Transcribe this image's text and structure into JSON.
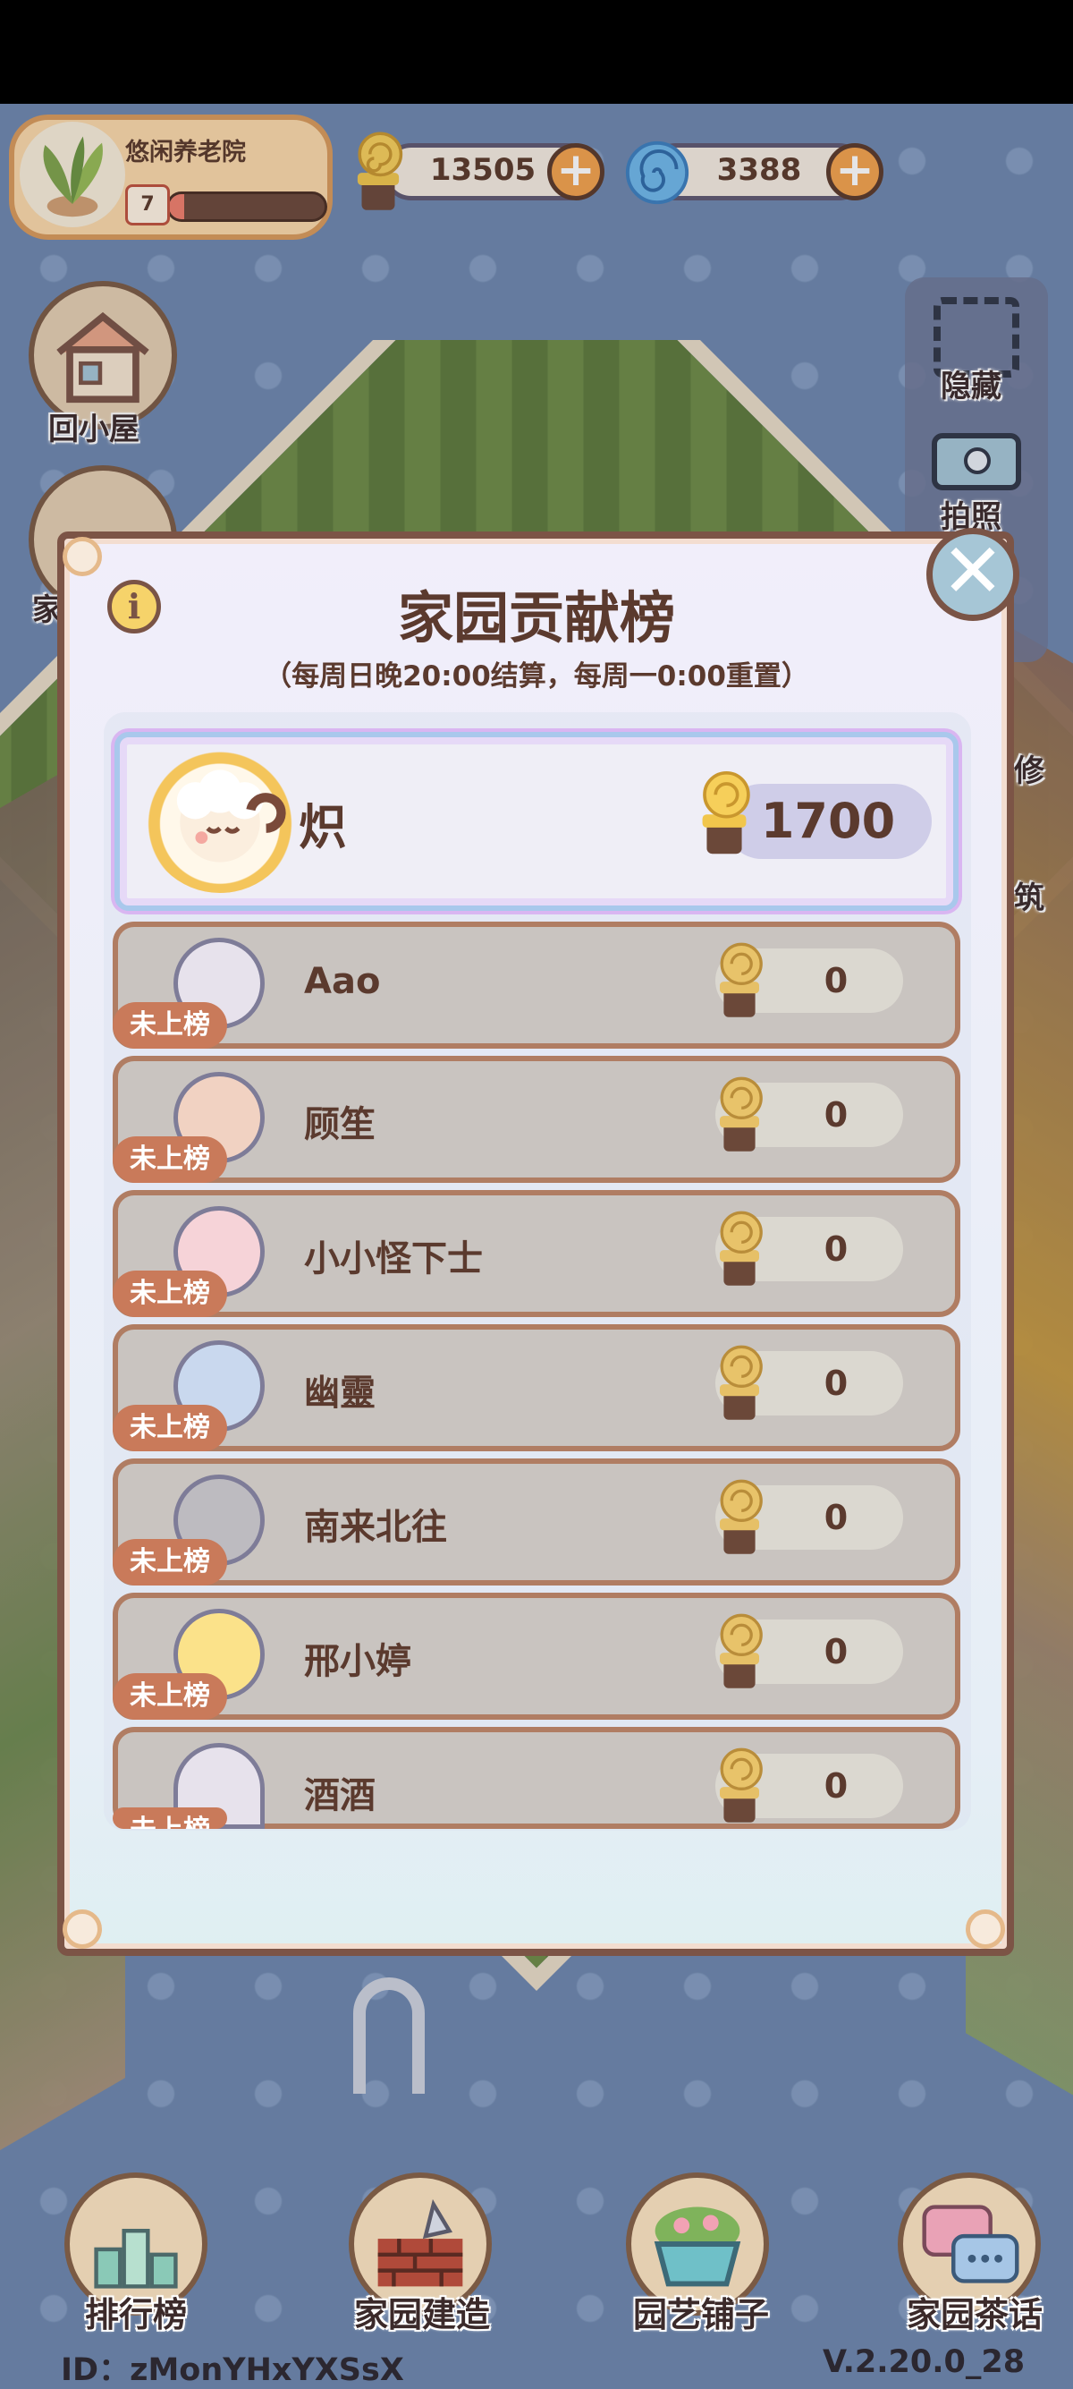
{
  "hud": {
    "garden_name": "悠闲养老院",
    "level": "7",
    "level_progress": 0.1,
    "snail_coins": "13505",
    "swirl_gems": "3388"
  },
  "side_buttons": {
    "home_label": "回小屋",
    "gift_label_partial": "家",
    "hide_label": "隐藏",
    "photo_label": "拍照",
    "edge_label_1": "修",
    "edge_label_2": "筑"
  },
  "modal": {
    "title": "家园贡献榜",
    "subtitle": "（每周日晚20:00结算，每周一0:00重置）",
    "top_entry": {
      "name": "炽",
      "score": "1700"
    },
    "entries": [
      {
        "name": "Aao",
        "score": "0",
        "badge": "未上榜"
      },
      {
        "name": "顾笙",
        "score": "0",
        "badge": "未上榜"
      },
      {
        "name": "小小怪下士",
        "score": "0",
        "badge": "未上榜"
      },
      {
        "name": "幽靈",
        "score": "0",
        "badge": "未上榜"
      },
      {
        "name": "南来北往",
        "score": "0",
        "badge": "未上榜"
      },
      {
        "name": "邢小婷",
        "score": "0",
        "badge": "未上榜"
      },
      {
        "name": "酒酒",
        "score": "0",
        "badge": "未上榜"
      }
    ]
  },
  "bottom_nav": {
    "ranking": "排行榜",
    "build": "家园建造",
    "shop": "园艺铺子",
    "chat": "家园茶话"
  },
  "footer": {
    "user_id": "ID：zMonYHxYXSsX",
    "version": "V.2.20.0_28"
  },
  "colors": {
    "background": "#6e87ad",
    "accent": "#f3a24c",
    "badge": "#c97a5a",
    "text": "#5b3a2e"
  }
}
